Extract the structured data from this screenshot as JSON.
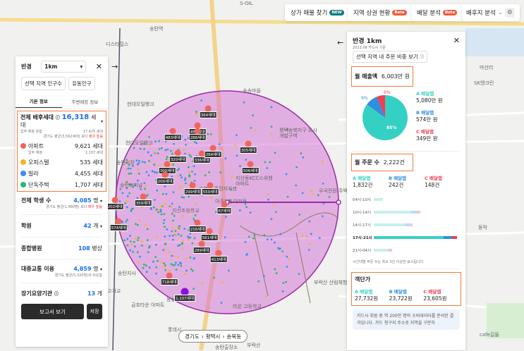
{
  "topbar": {
    "items": [
      {
        "label": "상가 매물 찾기",
        "badge": "NEW"
      },
      {
        "label": "지역 상권 현황",
        "badge": "Beta"
      },
      {
        "label": "배달 분석",
        "badge": "Beta"
      },
      {
        "label": "배후지 분석"
      }
    ]
  },
  "map": {
    "labels": [
      "S-OIL",
      "송탄역",
      "디스타힐스",
      "현대오일뱅크",
      "송송마을",
      "현대오일뱅크",
      "평택송북지구 도시개발구역",
      "송탄시장",
      "송탄터미널",
      "송북동 주민자치센터",
      "지산동KCC스위첸 아파트",
      "아주1차 아파트",
      "지산초등학교",
      "우곡전원 주택마을",
      "송탄지사",
      "고가교",
      "금호타운 아파트",
      "동산아파트",
      "라온 고등학교",
      "부락산 산림체험장",
      "마산리",
      "SK엔크린",
      "동막",
      "롯데시",
      "송탄출장소",
      "부락산",
      "cafe길들"
    ],
    "markers": [
      "364세대",
      "453세대",
      "286세대",
      "483세대",
      "320세대",
      "336세대",
      "264세대",
      "305세대",
      "506세대",
      "300세대",
      "200세대",
      "299세대",
      "550세대",
      "202세대",
      "359세대",
      "67세대",
      "574세대",
      "216세대",
      "561세대",
      "289세대",
      "413세대",
      "718세대",
      "1,107세대"
    ],
    "breadcrumb": [
      "경기도",
      "평택시",
      "송북동"
    ],
    "colors": {
      "circle": "#d26bd6",
      "edge": "#9b2aa8"
    }
  },
  "left": {
    "radius_label": "반경",
    "radius_value": "1km",
    "tabs_pop": [
      "선택 지역 인구수",
      "유동인구"
    ],
    "tabs": [
      "기본 정보",
      "주변매장 정보"
    ],
    "households": {
      "title": "전체 배후세대",
      "value": "16,318",
      "unit": "세대",
      "planned_label": "입주 예정 포함",
      "planned_value": "17,425 세대",
      "compare": "경기도 평균(3,562세대) 보다",
      "compare_hl": "매우 높음",
      "items": [
        {
          "name": "아파트",
          "value": "9,621 세대",
          "sub_label": "입주 예정",
          "sub_value": "1,107 세대",
          "color": "#f0665a"
        },
        {
          "name": "오피스텔",
          "value": "535 세대",
          "color": "#f5b324"
        },
        {
          "name": "빌라",
          "value": "4,455 세대",
          "color": "#3d8ef5"
        },
        {
          "name": "단독주택",
          "value": "1,707 세대",
          "color": "#2bb673"
        }
      ]
    },
    "students": {
      "title": "전체 학생 수",
      "value": "4,085",
      "unit": "명",
      "compare": "경기도 평균(1,480명) 보다",
      "compare_hl": "매우 높음"
    },
    "academy": {
      "title": "학원",
      "value": "42",
      "unit": "개"
    },
    "hospital": {
      "title": "종합병원",
      "value": "108",
      "unit": "병상"
    },
    "transit": {
      "title": "대중교통 이용",
      "value": "4,859",
      "unit": "명",
      "compare": "경기도 평균(5,320명)과 비슷함"
    },
    "care": {
      "title": "장기요양기관",
      "value": "13",
      "unit": "개"
    },
    "report_btn": "보고서 보기",
    "save_btn": "저장"
  },
  "right": {
    "title": "반경 1km",
    "basis": "2023.08 카드사 기준",
    "share_btn": "선택 지역 내 주문 비중 보기",
    "sales": {
      "title": "월 매출액",
      "value": "6,003만 원"
    },
    "apps": [
      {
        "name": "A 배달앱",
        "sales": "5,080만 원",
        "orders": "1,832건",
        "avg": "27,732원",
        "pct": 85,
        "color": "#35d0c4"
      },
      {
        "name": "B 배달앱",
        "sales": "574만 원",
        "orders": "242건",
        "avg": "23,722원",
        "pct": 9,
        "color": "#2e8fe0"
      },
      {
        "name": "C 배달앱",
        "sales": "349만 원",
        "orders": "148건",
        "avg": "23,605원",
        "pct": 6,
        "color": "#ee3f55"
      }
    ],
    "pie_labels": [
      "85%",
      "9%",
      "6%"
    ],
    "orders": {
      "title": "월 주문 수",
      "value": "2,222건"
    },
    "slots": [
      {
        "label": "04시-10시",
        "total": 0.11,
        "split": [
          1,
          0,
          0
        ]
      },
      {
        "label": "10시-14시",
        "total": 0.56,
        "split": [
          0.8,
          0.14,
          0.06
        ]
      },
      {
        "label": "14시-17시",
        "total": 0.47,
        "split": [
          0.8,
          0.13,
          0.07
        ]
      },
      {
        "label": "17시-21시",
        "total": 1.0,
        "split": [
          0.84,
          0.1,
          0.06
        ],
        "highlight": true
      },
      {
        "label": "21시-04시",
        "total": 0.22,
        "split": [
          0.82,
          0,
          0.18
        ]
      }
    ],
    "slot_note": "시간대별 주문 수는 최소 3건 이상만 표시됩니다.",
    "avg": {
      "title": "객단가"
    },
    "info": "카드사 회원 중 약 200만 명의 소비데이터를 분석한 결과입니다. 카드 청구지 주소로 지역을 구분하"
  }
}
